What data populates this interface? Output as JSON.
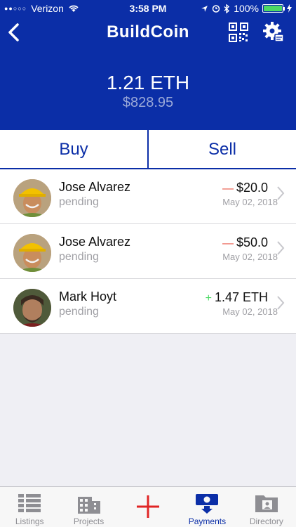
{
  "status_bar": {
    "carrier": "Verizon",
    "time": "3:58 PM",
    "battery": "100%"
  },
  "header": {
    "title": "BuildCoin",
    "back_icon": "chevron-left-icon",
    "qr_icon": "qr-code-icon",
    "settings_icon": "gear-icon"
  },
  "balance": {
    "eth": "1.21 ETH",
    "usd": "$828.95"
  },
  "actions": {
    "buy": "Buy",
    "sell": "Sell"
  },
  "transactions": [
    {
      "name": "Jose Alvarez",
      "status": "pending",
      "sign": "—",
      "direction": "out",
      "amount": "$20.0",
      "date": "May 02, 2018"
    },
    {
      "name": "Jose Alvarez",
      "status": "pending",
      "sign": "—",
      "direction": "out",
      "amount": "$50.0",
      "date": "May 02, 2018"
    },
    {
      "name": "Mark Hoyt",
      "status": "pending",
      "sign": "+",
      "direction": "in",
      "amount": "1.47 ETH",
      "date": "May 02, 2018"
    }
  ],
  "tab_bar": {
    "items": [
      {
        "label": "Listings",
        "icon": "list-icon"
      },
      {
        "label": "Projects",
        "icon": "building-icon"
      },
      {
        "label": "",
        "icon": "plus-icon"
      },
      {
        "label": "Payments",
        "icon": "payment-icon",
        "active": true
      },
      {
        "label": "Directory",
        "icon": "folder-contact-icon"
      }
    ]
  },
  "colors": {
    "brand": "#0b2ea7",
    "negative": "#e74c3c",
    "positive": "#4cd964"
  }
}
